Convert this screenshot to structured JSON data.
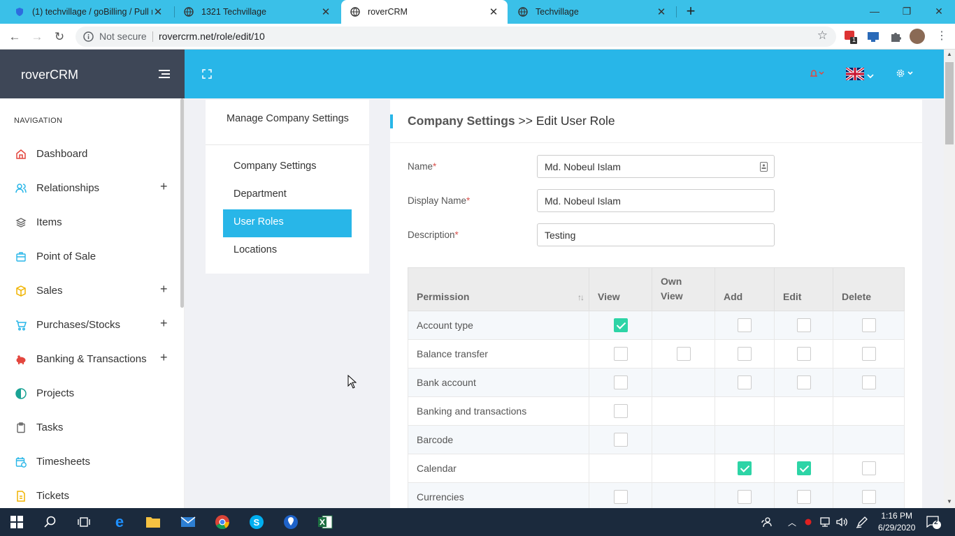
{
  "browser": {
    "tabs": [
      {
        "title": "(1) techvillage / goBilling / Pull re"
      },
      {
        "title": "1321 Techvillage"
      },
      {
        "title": "roverCRM"
      },
      {
        "title": "Techvillage"
      }
    ],
    "security_label": "Not secure",
    "url": "rovercrm.net/role/edit/10",
    "ext_badge": "1"
  },
  "app": {
    "brand": "roverCRM",
    "nav_label": "NAVIGATION",
    "nav": [
      {
        "label": "Dashboard",
        "icon": "home-icon",
        "expand": ""
      },
      {
        "label": "Relationships",
        "icon": "users-icon",
        "expand": "+"
      },
      {
        "label": "Items",
        "icon": "layers-icon",
        "expand": ""
      },
      {
        "label": "Point of Sale",
        "icon": "pos-icon",
        "expand": ""
      },
      {
        "label": "Sales",
        "icon": "box-icon",
        "expand": "+"
      },
      {
        "label": "Purchases/Stocks",
        "icon": "cart-icon",
        "expand": "+"
      },
      {
        "label": "Banking & Transactions",
        "icon": "piggy-bank-icon",
        "expand": "+"
      },
      {
        "label": "Projects",
        "icon": "half-circle-icon",
        "expand": ""
      },
      {
        "label": "Tasks",
        "icon": "clipboard-icon",
        "expand": ""
      },
      {
        "label": "Timesheets",
        "icon": "calendar-clock-icon",
        "expand": ""
      },
      {
        "label": "Tickets",
        "icon": "ticket-icon",
        "expand": ""
      }
    ]
  },
  "settings_menu": {
    "heading": "Manage Company Settings",
    "links": [
      "Company Settings",
      "Department",
      "User Roles",
      "Locations"
    ],
    "active": "User Roles"
  },
  "form": {
    "breadcrumb_parent": "Company Settings",
    "breadcrumb_sep": " >> ",
    "breadcrumb_current": "Edit User Role",
    "name_label": "Name",
    "name_value": "Md. Nobeul Islam",
    "display_name_label": "Display Name",
    "display_name_value": "Md. Nobeul Islam",
    "description_label": "Description",
    "description_value": "Testing",
    "required_mark": "*"
  },
  "permissions": {
    "columns": [
      "Permission",
      "View",
      "Own View",
      "Add",
      "Edit",
      "Delete"
    ],
    "sort_icon": "↑↓",
    "rows": [
      {
        "name": "Account type",
        "view": true,
        "own_view": null,
        "add": false,
        "edit": false,
        "delete": false
      },
      {
        "name": "Balance transfer",
        "view": false,
        "own_view": false,
        "add": false,
        "edit": false,
        "delete": false
      },
      {
        "name": "Bank account",
        "view": false,
        "own_view": null,
        "add": false,
        "edit": false,
        "delete": false
      },
      {
        "name": "Banking and transactions",
        "view": false,
        "own_view": null,
        "add": null,
        "edit": null,
        "delete": null
      },
      {
        "name": "Barcode",
        "view": false,
        "own_view": null,
        "add": null,
        "edit": null,
        "delete": null
      },
      {
        "name": "Calendar",
        "view": null,
        "own_view": null,
        "add": true,
        "edit": true,
        "delete": false
      },
      {
        "name": "Currencies",
        "view": false,
        "own_view": null,
        "add": false,
        "edit": false,
        "delete": false
      }
    ]
  },
  "taskbar": {
    "time": "1:16 PM",
    "date": "6/29/2020",
    "notifications": "2"
  }
}
